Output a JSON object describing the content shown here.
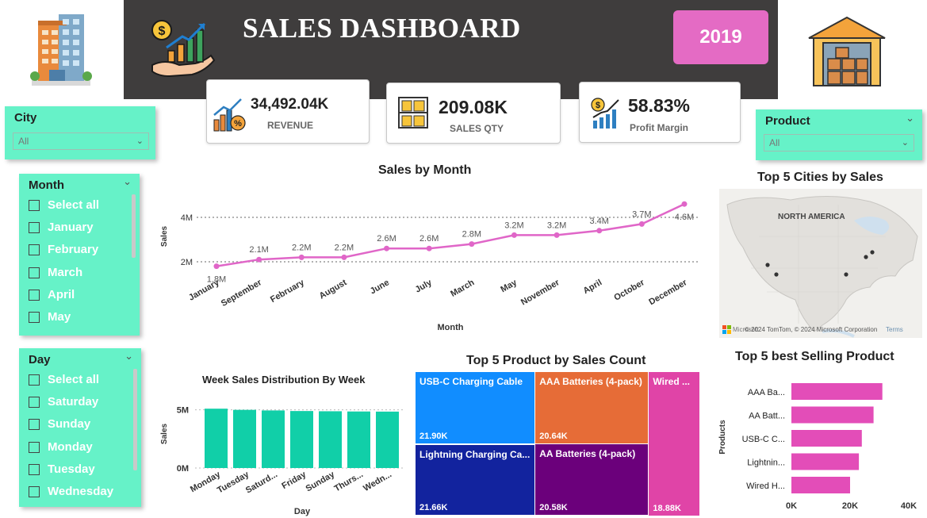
{
  "header": {
    "title": "SALES DASHBOARD",
    "year": "2019"
  },
  "kpis": [
    {
      "value": "34,492.04K",
      "label": "REVENUE"
    },
    {
      "value": "209.08K",
      "label": "SALES QTY"
    },
    {
      "value": "58.83%",
      "label": "Profit Margin"
    }
  ],
  "slicers": {
    "city": {
      "title": "City",
      "value": "All"
    },
    "product": {
      "title": "Product",
      "value": "All"
    },
    "month": {
      "title": "Month",
      "options": [
        "Select all",
        "January",
        "February",
        "March",
        "April",
        "May"
      ]
    },
    "day": {
      "title": "Day",
      "options": [
        "Select all",
        "Saturday",
        "Sunday",
        "Monday",
        "Tuesday",
        "Wednesday"
      ]
    }
  },
  "colors": {
    "header": "#3f3d3d",
    "accent_pink": "#e46bc4",
    "slicer": "#66f2c8",
    "line": "#e066c8",
    "bar_teal": "#11cfa8",
    "bar_pink": "#e34db8"
  },
  "map": {
    "label": "NORTH AMERICA",
    "attribution": "© 2024 TomTom, © 2024 Microsoft Corporation",
    "terms": "Terms",
    "logo_text": "Microsoft"
  },
  "chart_data": [
    {
      "type": "line",
      "title": "Sales by Month",
      "xlabel": "Month",
      "ylabel": "Sales",
      "categories": [
        "January",
        "September",
        "February",
        "August",
        "June",
        "July",
        "March",
        "May",
        "November",
        "April",
        "October",
        "December"
      ],
      "values": [
        1.8,
        2.1,
        2.2,
        2.2,
        2.6,
        2.6,
        2.8,
        3.2,
        3.2,
        3.4,
        3.7,
        4.6
      ],
      "data_labels": [
        "1.8M",
        "2.1M",
        "2.2M",
        "2.2M",
        "2.6M",
        "2.6M",
        "2.8M",
        "3.2M",
        "3.2M",
        "3.4M",
        "3.7M",
        "4.6M"
      ],
      "yticks": [
        "2M",
        "4M"
      ],
      "ylim": [
        1.5,
        5
      ]
    },
    {
      "type": "bar",
      "title": "Week Sales Distribution By Week",
      "xlabel": "Day",
      "ylabel": "Sales",
      "categories": [
        "Monday",
        "Tuesday",
        "Saturd...",
        "Friday",
        "Sunday",
        "Thurs...",
        "Wedn..."
      ],
      "values": [
        5.1,
        5.0,
        4.95,
        4.9,
        4.88,
        4.86,
        4.85
      ],
      "yticks": [
        "0M",
        "5M"
      ],
      "ylim": [
        0,
        6
      ]
    },
    {
      "type": "treemap",
      "title": "Top 5 Product by Sales Count",
      "items": [
        {
          "name": "USB-C Charging Cable",
          "label": "21.90K",
          "value": 21.9,
          "color": "#118dff"
        },
        {
          "name": "Lightning Charging Ca...",
          "label": "21.66K",
          "value": 21.66,
          "color": "#12239e"
        },
        {
          "name": "AAA Batteries (4-pack)",
          "label": "20.64K",
          "value": 20.64,
          "color": "#e66c37"
        },
        {
          "name": "AA Batteries (4-pack)",
          "label": "20.58K",
          "value": 20.58,
          "color": "#6b007b"
        },
        {
          "name": "Wired ...",
          "label": "18.88K",
          "value": 18.88,
          "color": "#e044a7"
        }
      ]
    },
    {
      "type": "bar",
      "orientation": "horizontal",
      "title": "Top 5 best Selling Product",
      "ylabel": "Products",
      "categories": [
        "AAA Ba...",
        "AA Batt...",
        "USB-C C...",
        "Lightnin...",
        "Wired H..."
      ],
      "values": [
        31,
        28,
        24,
        23,
        20
      ],
      "xticks": [
        "0K",
        "20K",
        "40K"
      ],
      "xlim": [
        0,
        40
      ]
    },
    {
      "type": "map",
      "title": "Top 5 Cities by Sales"
    }
  ]
}
